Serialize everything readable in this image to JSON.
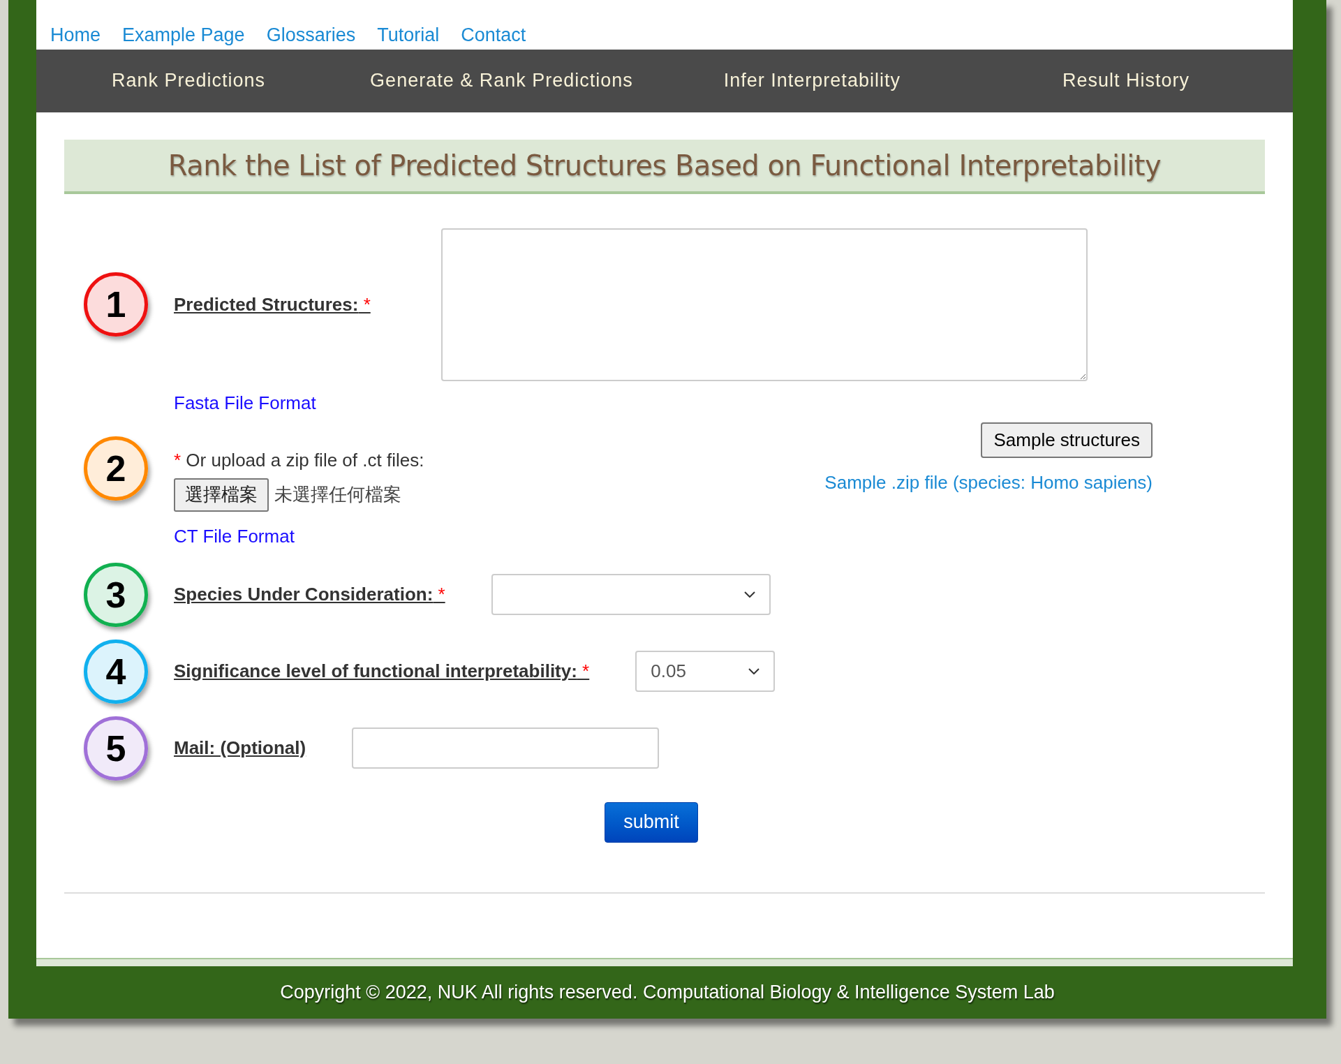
{
  "top_links": [
    "Home",
    "Example Page",
    "Glossaries",
    "Tutorial",
    "Contact"
  ],
  "nav": [
    "Rank Predictions",
    "Generate & Rank Predictions",
    "Infer Interpretability",
    "Result History"
  ],
  "heading": "Rank the List of Predicted Structures Based on Functional Interpretability",
  "steps": [
    {
      "number": "1",
      "color": "#ee1111",
      "kind": "textarea",
      "label": "Predicted Structures:",
      "asterisk": "*",
      "link": "Fasta File Format"
    },
    {
      "number": "2",
      "color": "#ff8800",
      "kind": "upload",
      "asterisk": "*",
      "label": "Or upload a zip file of .ct files:",
      "file_button": "選擇檔案",
      "file_status": "未選擇任何檔案",
      "link": "CT File Format",
      "sample_button": "Sample structures",
      "sample_link": "Sample .zip file (species: Homo sapiens)"
    },
    {
      "number": "3",
      "color": "#11b050",
      "kind": "select",
      "label": "Species Under Consideration:",
      "asterisk": "*"
    },
    {
      "number": "4",
      "color": "#11b0ee",
      "kind": "select",
      "label": "Significance level of functional interpretability:",
      "asterisk": "*",
      "value": "0.05"
    },
    {
      "number": "5",
      "color": "#a070d8",
      "kind": "input",
      "label": "Mail: (Optional)"
    }
  ],
  "submit": "submit",
  "footer": "Copyright © 2022, NUK All rights reserved. Computational Biology & Intelligence System Lab"
}
